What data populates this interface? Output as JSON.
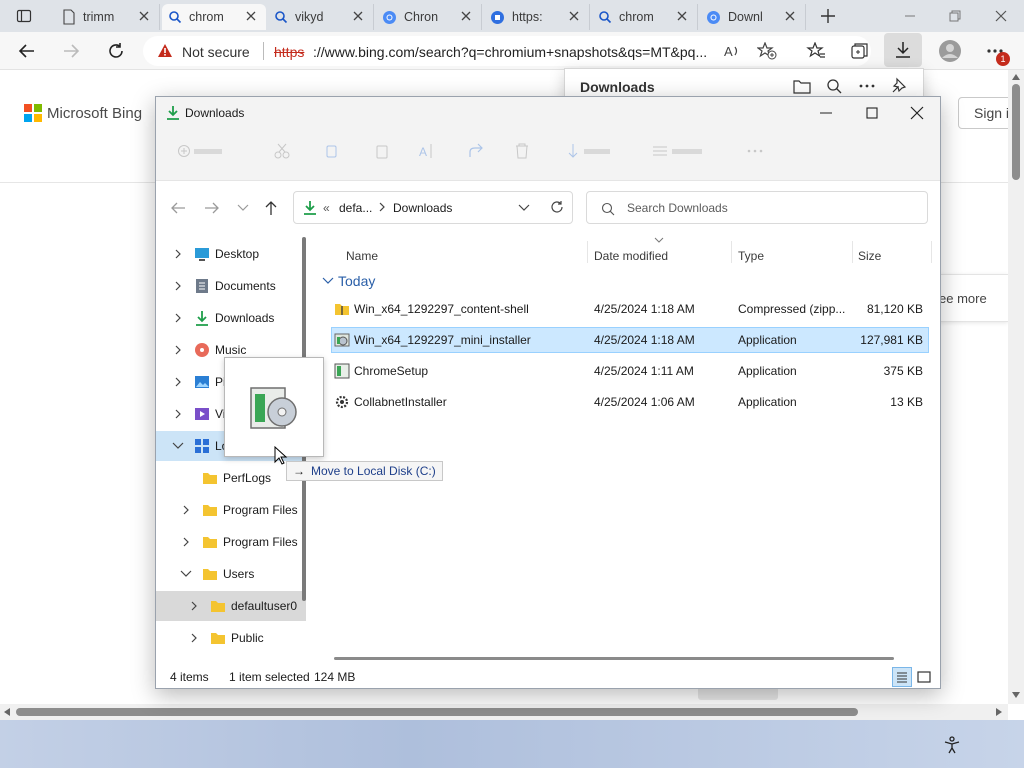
{
  "browser": {
    "tabs": [
      {
        "label": "trimm",
        "icon": "page-icon",
        "active": false
      },
      {
        "label": "chrom",
        "icon": "search-icon",
        "active": true
      },
      {
        "label": "vikyd",
        "icon": "search-icon",
        "active": false
      },
      {
        "label": "Chron",
        "icon": "chromium-icon",
        "active": false
      },
      {
        "label": "https:",
        "icon": "extension-icon",
        "active": false
      },
      {
        "label": "chrom",
        "icon": "search-icon",
        "active": false
      },
      {
        "label": "Downl",
        "icon": "chromium-icon",
        "active": false
      }
    ],
    "security_label": "Not secure",
    "url_scheme": "https",
    "url_rest": "://www.bing.com/search?q=chromium+snapshots&qs=MT&pq...",
    "downloads_badge": "1"
  },
  "bing": {
    "logo_text": "Microsoft Bing",
    "sign_in": "Sign i",
    "see_more": "ee more"
  },
  "downloads_flyout": {
    "title": "Downloads"
  },
  "explorer": {
    "title": "Downloads",
    "breadcrumb": {
      "prefix": "«",
      "parent": "defa...",
      "current": "Downloads"
    },
    "search_placeholder": "Search Downloads",
    "sidebar": [
      {
        "label": "Desktop",
        "icon": "desktop-icon"
      },
      {
        "label": "Documents",
        "icon": "documents-icon"
      },
      {
        "label": "Downloads",
        "icon": "downloads-icon"
      },
      {
        "label": "Music",
        "icon": "music-icon"
      },
      {
        "label": "Pi",
        "icon": "pictures-icon"
      },
      {
        "label": "Vi",
        "icon": "videos-icon"
      },
      {
        "label": "Lo",
        "icon": "local-disk-icon"
      },
      {
        "label": "PerfLogs",
        "icon": "folder-icon"
      },
      {
        "label": "Program Files",
        "icon": "folder-icon"
      },
      {
        "label": "Program Files",
        "icon": "folder-icon"
      },
      {
        "label": "Users",
        "icon": "folder-icon"
      },
      {
        "label": "defaultuser0",
        "icon": "folder-icon"
      },
      {
        "label": "Public",
        "icon": "folder-icon"
      }
    ],
    "columns": [
      "Name",
      "Date modified",
      "Type",
      "Size"
    ],
    "group_label": "Today",
    "files": [
      {
        "name": "Win_x64_1292297_content-shell",
        "date": "4/25/2024 1:18 AM",
        "type": "Compressed (zipp...",
        "size": "81,120 KB",
        "icon": "zip-folder-icon"
      },
      {
        "name": "Win_x64_1292297_mini_installer",
        "date": "4/25/2024 1:18 AM",
        "type": "Application",
        "size": "127,981 KB",
        "icon": "installer-icon"
      },
      {
        "name": "ChromeSetup",
        "date": "4/25/2024 1:11 AM",
        "type": "Application",
        "size": "375 KB",
        "icon": "setup-icon"
      },
      {
        "name": "CollabnetInstaller",
        "date": "4/25/2024 1:06 AM",
        "type": "Application",
        "size": "13 KB",
        "icon": "installer-gear-icon"
      }
    ],
    "status": {
      "count": "4 items",
      "selected": "1 item selected",
      "size": "124 MB"
    },
    "drag_tooltip": {
      "arrow": "→",
      "text": "Move to Local Disk (C:)"
    }
  },
  "colors": {
    "accent": "#0067c0",
    "selection": "#cce8ff",
    "folder": "#f4c430"
  }
}
